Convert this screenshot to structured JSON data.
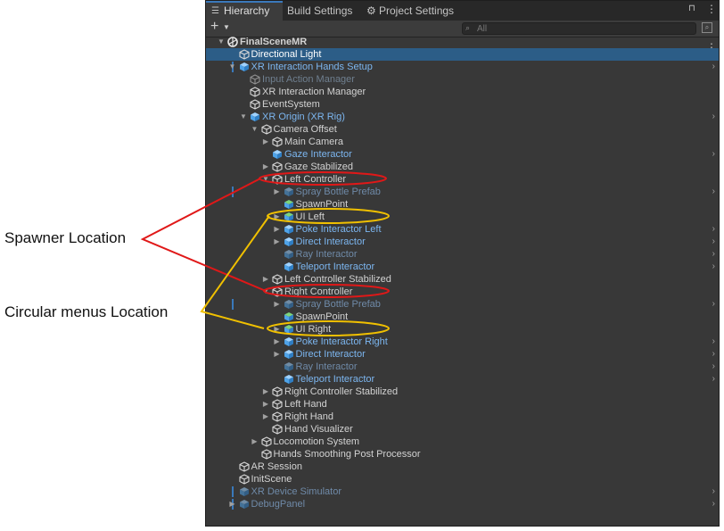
{
  "annotations": {
    "spawner": "Spawner Location",
    "circular": "Circular menus Location"
  },
  "tabs": [
    {
      "label": "Hierarchy",
      "icon": "list-icon"
    },
    {
      "label": "Build Settings"
    },
    {
      "label": "Project Settings",
      "icon": "gear-icon"
    }
  ],
  "search": {
    "placeholder": "All"
  },
  "hierarchy": [
    {
      "label": "FinalSceneMR",
      "depth": 0,
      "arrow": "down",
      "type": "scene"
    },
    {
      "label": "Directional Light",
      "depth": 1,
      "arrow": "none",
      "selected": true
    },
    {
      "label": "XR Interaction Hands Setup",
      "depth": 1,
      "arrow": "down",
      "blue": true,
      "chevron": true,
      "bar": true
    },
    {
      "label": "Input Action Manager",
      "depth": 2,
      "arrow": "none",
      "dim": true
    },
    {
      "label": "XR Interaction Manager",
      "depth": 2,
      "arrow": "none"
    },
    {
      "label": "EventSystem",
      "depth": 2,
      "arrow": "none"
    },
    {
      "label": "XR Origin (XR Rig)",
      "depth": 2,
      "arrow": "down",
      "blue": true,
      "chevron": true
    },
    {
      "label": "Camera Offset",
      "depth": 3,
      "arrow": "down"
    },
    {
      "label": "Main Camera",
      "depth": 4,
      "arrow": "right"
    },
    {
      "label": "Gaze Interactor",
      "depth": 4,
      "arrow": "none",
      "blue": true,
      "chevron": true
    },
    {
      "label": "Gaze Stabilized",
      "depth": 4,
      "arrow": "right"
    },
    {
      "label": "Left Controller",
      "depth": 4,
      "arrow": "down"
    },
    {
      "label": "Spray Bottle Prefab",
      "depth": 5,
      "arrow": "right",
      "dim": true,
      "blue": true,
      "chevron": true,
      "bar": true
    },
    {
      "label": "SpawnPoint",
      "depth": 5,
      "arrow": "none",
      "green": true
    },
    {
      "label": "UI Left",
      "depth": 5,
      "arrow": "right",
      "green": true
    },
    {
      "label": "Poke Interactor Left",
      "depth": 5,
      "arrow": "right",
      "blue": true,
      "chevron": true
    },
    {
      "label": "Direct Interactor",
      "depth": 5,
      "arrow": "right",
      "blue": true,
      "chevron": true
    },
    {
      "label": "Ray Interactor",
      "depth": 5,
      "arrow": "none",
      "dim": true,
      "blue": true,
      "chevron": true
    },
    {
      "label": "Teleport Interactor",
      "depth": 5,
      "arrow": "none",
      "blue": true,
      "chevron": true
    },
    {
      "label": "Left Controller Stabilized",
      "depth": 4,
      "arrow": "right"
    },
    {
      "label": "Right Controller",
      "depth": 4,
      "arrow": "down"
    },
    {
      "label": "Spray Bottle Prefab",
      "depth": 5,
      "arrow": "right",
      "dim": true,
      "blue": true,
      "chevron": true,
      "bar": true
    },
    {
      "label": "SpawnPoint",
      "depth": 5,
      "arrow": "none",
      "green": true
    },
    {
      "label": "UI Right",
      "depth": 5,
      "arrow": "right",
      "green": true
    },
    {
      "label": "Poke Interactor Right",
      "depth": 5,
      "arrow": "right",
      "blue": true,
      "chevron": true
    },
    {
      "label": "Direct Interactor",
      "depth": 5,
      "arrow": "right",
      "blue": true,
      "chevron": true
    },
    {
      "label": "Ray Interactor",
      "depth": 5,
      "arrow": "none",
      "dim": true,
      "blue": true,
      "chevron": true
    },
    {
      "label": "Teleport Interactor",
      "depth": 5,
      "arrow": "none",
      "blue": true,
      "chevron": true
    },
    {
      "label": "Right Controller Stabilized",
      "depth": 4,
      "arrow": "right"
    },
    {
      "label": "Left Hand",
      "depth": 4,
      "arrow": "right"
    },
    {
      "label": "Right Hand",
      "depth": 4,
      "arrow": "right"
    },
    {
      "label": "Hand Visualizer",
      "depth": 4,
      "arrow": "none"
    },
    {
      "label": "Locomotion System",
      "depth": 3,
      "arrow": "right"
    },
    {
      "label": "Hands Smoothing Post Processor",
      "depth": 3,
      "arrow": "none"
    },
    {
      "label": "AR Session",
      "depth": 1,
      "arrow": "none"
    },
    {
      "label": "InitScene",
      "depth": 1,
      "arrow": "none"
    },
    {
      "label": "XR Device Simulator",
      "depth": 1,
      "arrow": "none",
      "dim": true,
      "blue": true,
      "chevron": true,
      "bar": true
    },
    {
      "label": "DebugPanel",
      "depth": 1,
      "arrow": "right",
      "dim": true,
      "blue": true,
      "chevron": true,
      "bar": true
    }
  ],
  "colors": {
    "panel_bg": "#383838",
    "selected": "#2c5d87",
    "prefab_blue": "#7cb6f0",
    "annotation_red": "#e01818",
    "annotation_yellow": "#f0c000"
  }
}
